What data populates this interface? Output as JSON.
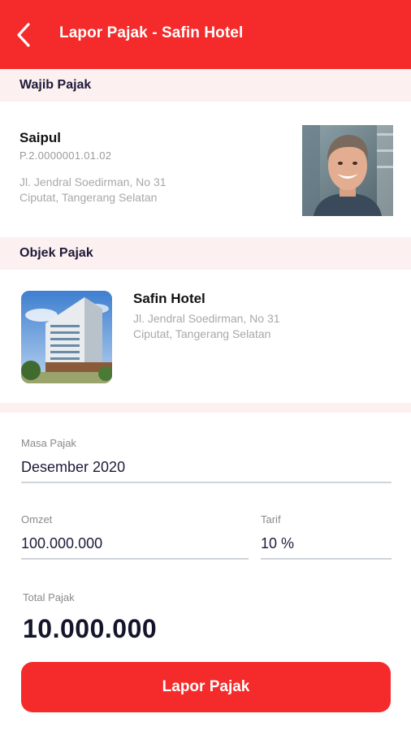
{
  "header": {
    "back_icon": "chevron-left-icon",
    "title": "Lapor Pajak - Safin Hotel",
    "background_color": "#f52a2a"
  },
  "wajib_pajak": {
    "section_title": "Wajib Pajak",
    "name": "Saipul",
    "npwpd": "P.2.0000001.01.02",
    "address_line1": "Jl. Jendral Soedirman, No 31",
    "address_line2": "Ciputat, Tangerang Selatan"
  },
  "objek_pajak": {
    "section_title": "Objek Pajak",
    "name": "Safin Hotel",
    "address_line1": "Jl. Jendral Soedirman, No 31",
    "address_line2": "Ciputat, Tangerang Selatan"
  },
  "form": {
    "masa_pajak": {
      "label": "Masa Pajak",
      "value": "Desember 2020"
    },
    "omzet": {
      "label": "Omzet",
      "value": "100.000.000"
    },
    "tarif": {
      "label": "Tarif",
      "value": "10 %"
    },
    "total_pajak": {
      "label": "Total Pajak",
      "value": "10.000.000"
    }
  },
  "submit": {
    "label": "Lapor Pajak",
    "color": "#f52a2a"
  }
}
